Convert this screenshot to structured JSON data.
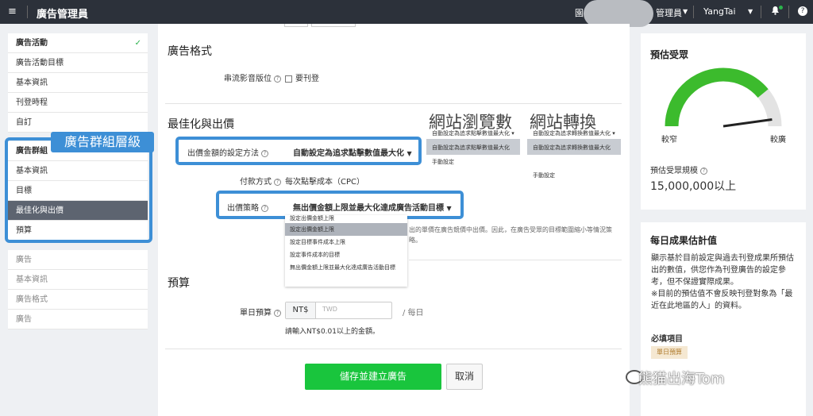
{
  "topbar": {
    "menu_icon": "menu-icon",
    "title": "廣告管理員",
    "cut_text": "園",
    "account": "管理員",
    "user": "YangTai",
    "bell_icon": "bell-icon",
    "help_icon": "help-icon",
    "caret": "▼",
    "question": "?"
  },
  "sidebar": {
    "campaign": [
      {
        "label": "廣告活動",
        "check": "✓"
      },
      {
        "label": "廣告活動目標"
      },
      {
        "label": "基本資訊"
      },
      {
        "label": "刊登時程"
      },
      {
        "label": "自訂"
      }
    ],
    "group": [
      {
        "label": "廣告群組"
      },
      {
        "label": "基本資訊"
      },
      {
        "label": "目標"
      },
      {
        "label": "最佳化與出價"
      },
      {
        "label": "預算"
      }
    ],
    "ad": [
      {
        "label": "廣告"
      },
      {
        "label": "基本資訊"
      },
      {
        "label": "廣告格式"
      },
      {
        "label": "廣告"
      }
    ],
    "group_overlay_label": "廣告群組層級"
  },
  "main": {
    "ad_format": {
      "title": "廣告格式",
      "stream_label": "串流影音版位",
      "stream_option": "要刊登"
    },
    "optimization": {
      "title": "最佳化與出價",
      "bid_method_label": "出價金額的設定方法",
      "bid_method_value": "自動設定為追求點擊數值最大化",
      "payment_label": "付款方式",
      "payment_value": "每次點擊成本（CPC）",
      "strategy_label": "出價策略",
      "strategy_value": "無出價金額上限並最大化達成廣告活動目標",
      "web_traffic_title": "網站瀏覽數",
      "web_conversion_title": "網站轉換",
      "traffic_head": "自動設定為追求點擊數值最大化",
      "traffic_opt1": "自動設定為追求點擊數值最大化",
      "traffic_opt2": "手動設定",
      "conv_head": "自動設定為追求轉換數值最大化",
      "conv_opt1": "自動設定為追求轉換數值最大化",
      "conv_opt2": "手動設定",
      "dropdown": [
        "設定出價金額上限",
        "設定出價金額上限",
        "設定目標事件成本上限",
        "設定事件成本的目標",
        "無出價金額上限並最大化達成廣告活動目標"
      ],
      "help_text": "出的單價在廣告競價中出價。因此，在廣告受眾的目標範圍縮小等情況策略。"
    },
    "budget": {
      "title": "預算",
      "daily_label": "單日預算",
      "currency": "NT$",
      "placeholder": "TWD",
      "unit": "/ 每日",
      "hint": "請輸入NT$0.01以上的金額。"
    },
    "buttons": {
      "save": "儲存並建立廣告",
      "cancel": "取消"
    }
  },
  "right": {
    "audience_title": "預估受眾",
    "narrow": "較窄",
    "wide": "較廣",
    "gauge_level": 0.78,
    "size_label": "預估受眾規模",
    "size_value": "15,000,000以上",
    "daily_title": "每日成果估計值",
    "daily_text1": "顯示基於目前設定與過去刊登成果所預估",
    "daily_text2": "出的數值，供您作為刊登廣告的設定參",
    "daily_text3": "考，但不保證實際成果。",
    "daily_text4": "※目前的預估值不會反映刊登對象為「最",
    "daily_text5": "近在此地區的人」的資料。",
    "required_title": "必填項目",
    "required_tag": "單日預算"
  },
  "watermark": "熊猫出海Tom",
  "colors": {
    "accent_blue": "#3d8fd6",
    "green": "#19c53d",
    "topbar": "#2c313a"
  }
}
